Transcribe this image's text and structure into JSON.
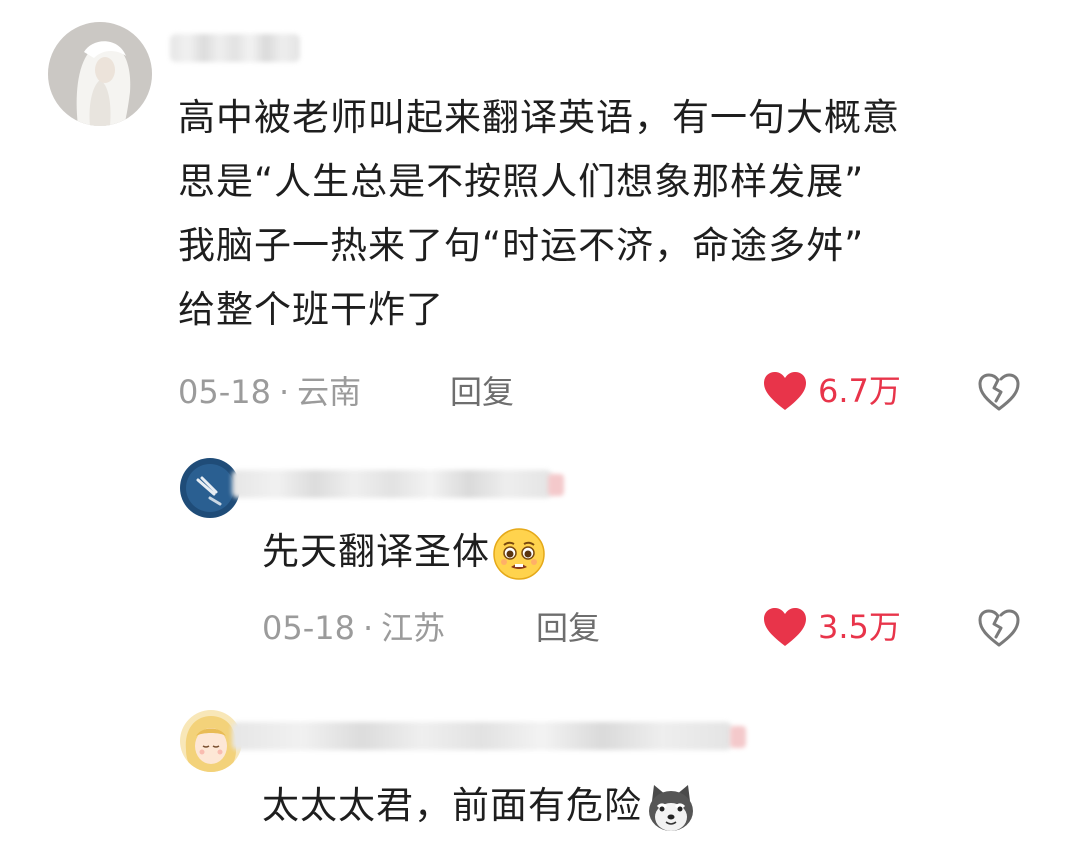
{
  "comments": [
    {
      "lines": [
        "高中被老师叫起来翻译英语，有一句大概意",
        "思是“人生总是不按照人们想象那样发展”",
        "我脑子一热来了句“时运不济，命途多舛”",
        "给整个班干炸了"
      ],
      "date": "05-18",
      "location": "云南",
      "reply_label": "回复",
      "likes": "6.7万"
    }
  ],
  "replies": [
    {
      "text": "先天翻译圣体",
      "emoji": "pleading-face-emoji",
      "date": "05-18",
      "location": "江苏",
      "reply_label": "回复",
      "likes": "3.5万"
    },
    {
      "text": "太太太君，前面有危险",
      "emoji": "shiba-dog-emoji"
    }
  ],
  "colors": {
    "like_red": "#e8344a",
    "meta_gray": "#9b9b9b",
    "text": "#1e1e1e"
  },
  "icons": {
    "like": "heart-icon",
    "dislike": "broken-heart-icon",
    "separator": "·"
  }
}
